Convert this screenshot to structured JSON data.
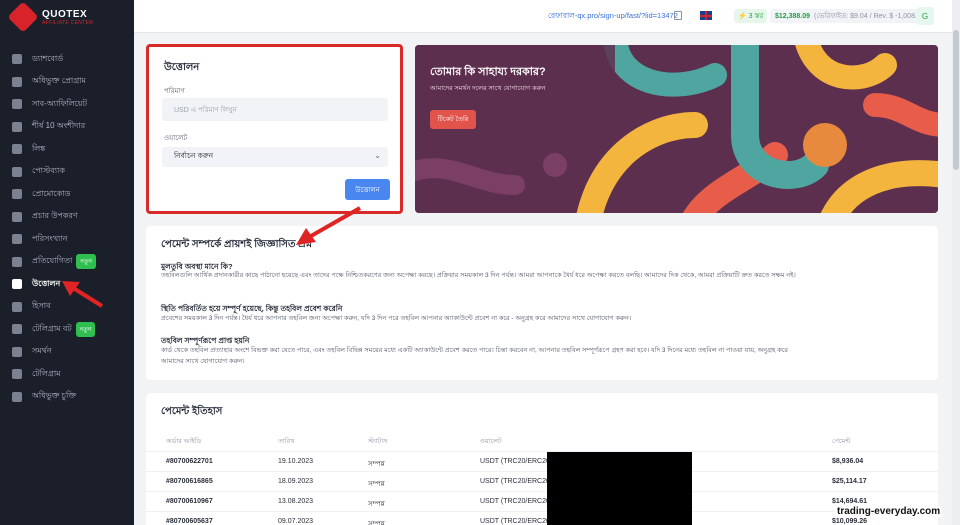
{
  "brand": {
    "name": "QUOTEX",
    "sub": "AFFILIATE CENTER"
  },
  "sidebar": {
    "items": [
      {
        "label": "ড্যাশবোর্ড",
        "icon": "grid-icon"
      },
      {
        "label": "অধিভুক্ত প্রোগ্রাম",
        "icon": "folder-icon"
      },
      {
        "label": "সাব-অ্যাফিলিয়েট",
        "icon": "send-icon"
      },
      {
        "label": "শীর্ষ 10 অংশীদার",
        "icon": "trend-icon"
      },
      {
        "label": "লিঙ্ক",
        "icon": "link-icon"
      },
      {
        "label": "পোস্টব্যাক",
        "icon": "cube-icon"
      },
      {
        "label": "প্রোমোকোড",
        "icon": "ticket-icon"
      },
      {
        "label": "প্রচার উপকরণ",
        "icon": "layers-icon"
      },
      {
        "label": "পরিসংখ্যান",
        "icon": "pie-icon"
      },
      {
        "label": "প্রতিযোগিতা",
        "icon": "trophy-icon",
        "badge": "নতুন"
      },
      {
        "label": "উত্তোলন",
        "icon": "wallet-icon",
        "active": true
      },
      {
        "label": "হিসাব",
        "icon": "user-icon"
      },
      {
        "label": "টেলিগ্রাম বট",
        "icon": "bot-icon",
        "badge": "নতুন"
      },
      {
        "label": "সমর্থন",
        "icon": "headset-icon"
      },
      {
        "label": "টেলিগ্রাম",
        "icon": "telegram-icon"
      },
      {
        "label": "অধিভুক্ত চুক্তি",
        "icon": "contract-icon"
      }
    ]
  },
  "topbar": {
    "ref_link": "রেফারাল-qx.pro/sign-up/fast/?lid=13472",
    "level": "3 স্তর",
    "balance": "$12,388.09",
    "balance_detail": "(ভেরিফাইড: $9.04 / Rev. $ -1,008.85)",
    "avatar_initial": "G"
  },
  "withdraw": {
    "title": "উত্তোলন",
    "amount_label": "পরিমাণ",
    "amount_placeholder": "USD এ পরিমাণ লিখুন",
    "wallet_label": "ওয়ালেট",
    "wallet_value": "নির্বাচন করুন",
    "submit_label": "উত্তোলন"
  },
  "help": {
    "title": "তোমার কি সাহায্য দরকার?",
    "subtitle": "আমাদের সমর্থন দলের সাথে যোগাযোগ করুন",
    "ticket_button": "টিকেট তৈরি"
  },
  "faq": {
    "title": "পেমেন্ট সম্পর্কে প্রায়শই জিজ্ঞাসিত প্রশ্ন",
    "items": [
      {
        "q": "মুলতুবি অবস্থা মানে কি?",
        "a": "তহবিলগুলি আর্থিক প্রদানকারীর কাছে পাঠানো হয়েছে এবং তাদের পক্ষে নিশ্চিতকরণের জন্য অপেক্ষা করছে। প্রক্রিয়ার সময়কাল 3 দিন পর্যন্ত। আমরা আপনাকে ধৈর্য ধরে অপেক্ষা করতে বলছি। আমাদের দিক থেকে, আমরা প্রক্রিয়াটি দ্রুত করতে সক্ষম নই।"
      },
      {
        "q": "স্থিতি পরিবর্তিত হয়ে সম্পূর্ণ হয়েছে, কিন্তু তহবিল প্রবেশ করেনি",
        "a": "প্রবেশের সময়কাল 3 দিন পর্যন্ত। ধৈর্য ধরে আপনার তহবিল জন্য অপেক্ষা করুন, যদি 3 দিন পরে তহবিল আপনার অ্যাকাউন্টে প্রবেশ না করে - অনুগ্রহ করে আমাদের সাথে যোগাযোগ করুন।"
      },
      {
        "q": "তহবিল সম্পূর্ণরূপে প্রাপ্ত হয়নি",
        "a": "কার্ড থেকে তহবিল প্রত্যাহার অংশে বিভক্ত করা যেতে পারে, এবং তহবিল বিভিন্ন সময়ের মধ্যে একটি অ্যাকাউন্টে প্রবেশ করতে পারে। চিন্তা করবেন না, আপনার তহবিল সম্পূর্ণরূপে গ্রহণ করা হবে। যদি 3 দিনের মধ্যে তহবিল না পাওয়া যায়, অনুগ্রহ করে আমাদের সাথে যোগাযোগ করুন।"
      }
    ]
  },
  "history": {
    "title": "পেমেন্ট ইতিহাস",
    "columns": [
      "অর্ডার আইডি",
      "তারিখ",
      "স্ট্যাটাস",
      "ওয়ালেট",
      "পেমেন্ট"
    ],
    "rows": [
      {
        "id": "#80700622701",
        "date": "19.10.2023",
        "status": "সম্পন্ন",
        "wallet": "USDT (TRC20/ERC20):",
        "amount": "$8,936.04"
      },
      {
        "id": "#80700616865",
        "date": "18.09.2023",
        "status": "সম্পন্ন",
        "wallet": "USDT (TRC20/ERC20):",
        "amount": "$25,114.17"
      },
      {
        "id": "#80700610967",
        "date": "13.08.2023",
        "status": "সম্পন্ন",
        "wallet": "USDT (TRC20/ERC20):",
        "amount": "$14,694.61"
      },
      {
        "id": "#80700605637",
        "date": "09.07.2023",
        "status": "সম্পন্ন",
        "wallet": "USDT (TRC20/ERC20):",
        "amount": "$10,099.26"
      }
    ]
  },
  "watermark": "trading-everyday.com",
  "colors": {
    "sidebar_bg": "#1b1f2a",
    "accent_red": "#d8232a",
    "primary_blue": "#4a86f0",
    "success_green": "#21a045",
    "banner_bg": "#5d2f4f"
  }
}
